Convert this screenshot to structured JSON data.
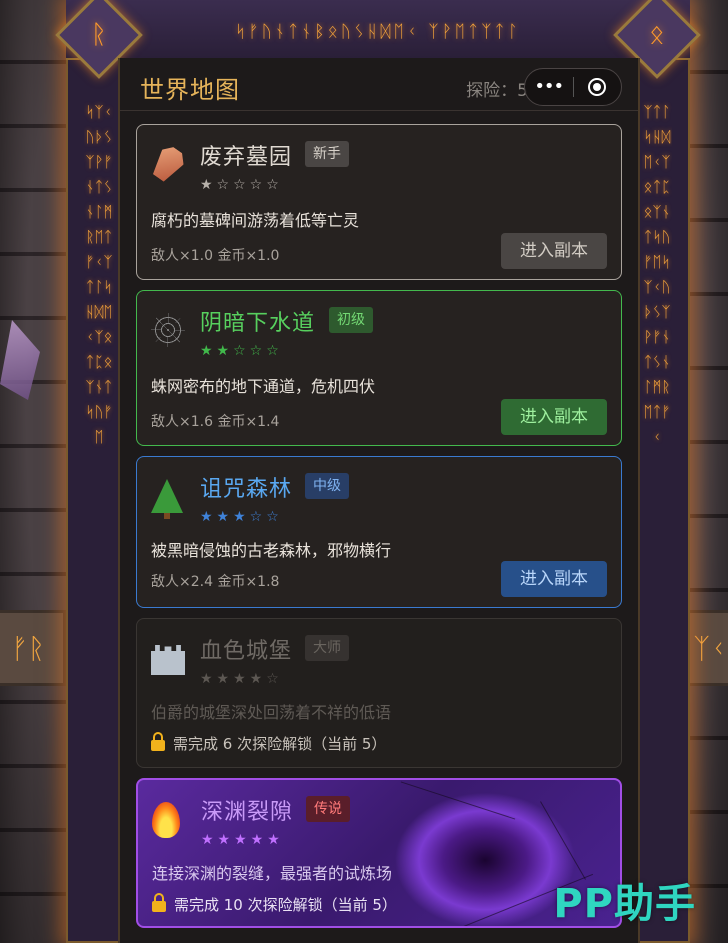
{
  "header": {
    "title": "世界地图",
    "explore_text": "探险：5",
    "capsule_dots": "•••"
  },
  "frame": {
    "top_runes": "ᛋᚠᚢᚾᛏᚾᛒᛟᚢᛊᚺᛞᛖᚲ ᛉᚹᛖᛏᛉᛏᛚ",
    "corner_left_rune": "ᚱ",
    "corner_right_rune": "ᛟ",
    "side_runes_left": "ᛋᛉᚲᚢᚦᛊᛉᚹᚠᚾᛏᛊᚾᛚᛗᚱᛖᛏᚠᚲᛉᛏᛚᛋᚺᛞᛖᚲᛉᛟᛏᛈᛟᛉᚾᛏᛋᚢᚠᛖ",
    "side_runes_right": "ᛉᛏᛚᛋᚺᛞᛖᚲᛉᛟᛏᛈᛟᛉᚾᛏᛋᚢᚠᛖᛋᛉᚲᚢᚦᛊᛉᚹᚠᚾᛏᛊᚾᛚᛗᚱᛖᛏᚠᚲ",
    "side_box_left": "ᚠᚱ",
    "side_box_right": "ᛉᚲ"
  },
  "dungeons": [
    {
      "name": "废弃墓园",
      "icon": "coffin-icon",
      "badge": "新手",
      "stars": "★☆☆☆☆",
      "description": "腐朽的墓碑间游荡着低等亡灵",
      "multipliers": "敌人×1.0  金币×1.0",
      "button": "进入副本",
      "locked": false
    },
    {
      "name": "阴暗下水道",
      "icon": "spiderweb-icon",
      "badge": "初级",
      "stars": "★★☆☆☆",
      "description": "蛛网密布的地下通道，危机四伏",
      "multipliers": "敌人×1.6  金币×1.4",
      "button": "进入副本",
      "locked": false
    },
    {
      "name": "诅咒森林",
      "icon": "tree-icon",
      "badge": "中级",
      "stars": "★★★☆☆",
      "description": "被黑暗侵蚀的古老森林，邪物横行",
      "multipliers": "敌人×2.4  金币×1.8",
      "button": "进入副本",
      "locked": false
    },
    {
      "name": "血色城堡",
      "icon": "castle-icon",
      "badge": "大师",
      "stars": "★★★★☆",
      "description": "伯爵的城堡深处回荡着不祥的低语",
      "lock_text": "需完成 6 次探险解锁（当前 5）",
      "locked": true
    },
    {
      "name": "深渊裂隙",
      "icon": "fire-icon",
      "badge": "传说",
      "stars": "★★★★★",
      "description": "连接深渊的裂缝，最强者的试炼场",
      "lock_text": "需完成 10 次探险解锁（当前 5）",
      "locked": true
    }
  ],
  "watermark": "PP助手",
  "colors": {
    "title": "#e6b45a",
    "tier_gray": "#a9a39c",
    "tier_green": "#43b94d",
    "tier_blue": "#3a7ad0",
    "tier_purple": "#a14ee6",
    "rune_glow": "#f2a23a",
    "lock_gold": "#f2b21c"
  }
}
